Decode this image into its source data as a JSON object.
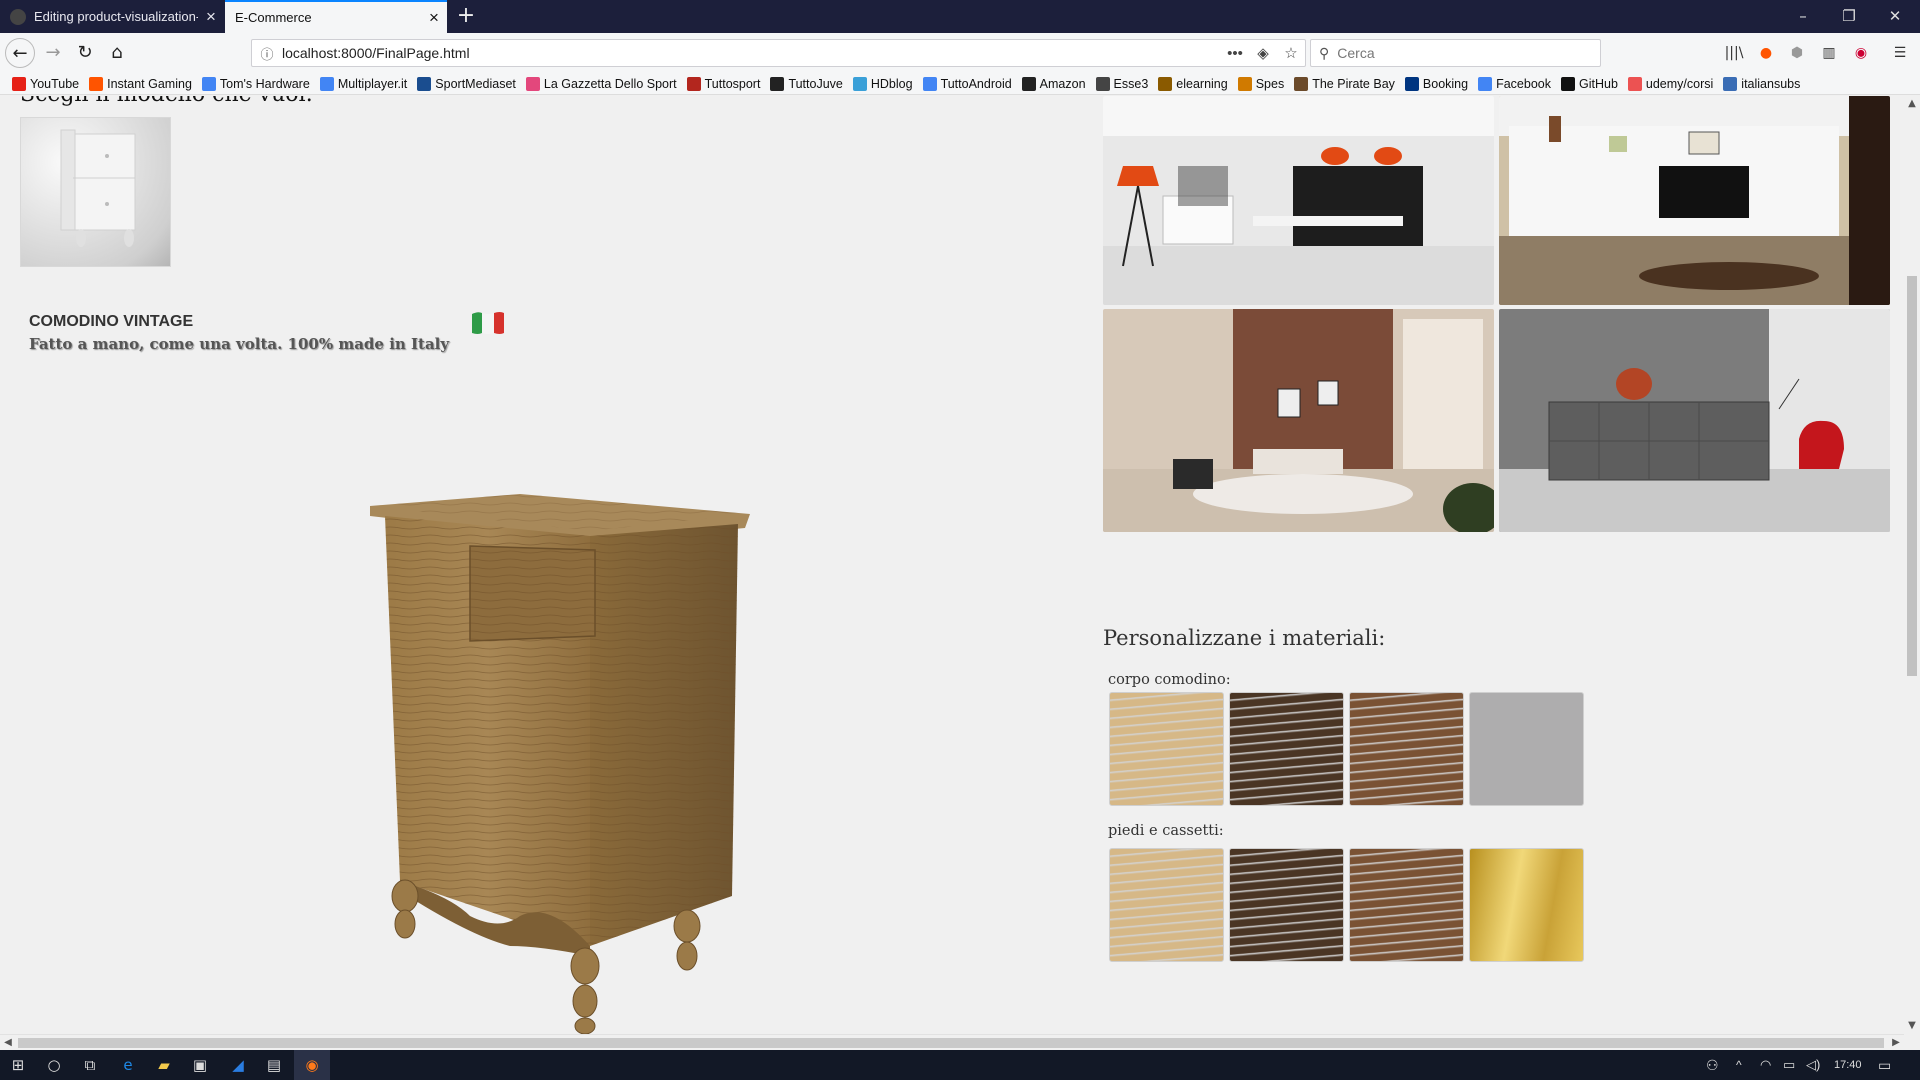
{
  "browser": {
    "tabs": [
      {
        "title": "Editing product-visualization-p",
        "active": false
      },
      {
        "title": "E-Commerce",
        "active": true
      }
    ],
    "url": "localhost:8000/FinalPage.html",
    "search_placeholder": "Cerca",
    "bookmarks": [
      {
        "label": "YouTube",
        "icon": "youtube-icon",
        "color": "#e62117"
      },
      {
        "label": "Instant Gaming",
        "icon": "instant-gaming-icon",
        "color": "#ff5400"
      },
      {
        "label": "Tom's Hardware",
        "icon": "google-icon",
        "color": "#4285f4"
      },
      {
        "label": "Multiplayer.it",
        "icon": "google-icon",
        "color": "#4285f4"
      },
      {
        "label": "SportMediaset",
        "icon": "sportmediaset-icon",
        "color": "#1a4d8f"
      },
      {
        "label": "La Gazzetta Dello Sport",
        "icon": "gazzetta-icon",
        "color": "#e3477c"
      },
      {
        "label": "Tuttosport",
        "icon": "tuttosport-icon",
        "color": "#b3261e"
      },
      {
        "label": "TuttoJuve",
        "icon": "tuttojuve-icon",
        "color": "#222222"
      },
      {
        "label": "HDblog",
        "icon": "hdblog-icon",
        "color": "#3aa0d8"
      },
      {
        "label": "TuttoAndroid",
        "icon": "google-icon",
        "color": "#4285f4"
      },
      {
        "label": "Amazon",
        "icon": "amazon-icon",
        "color": "#222222"
      },
      {
        "label": "Esse3",
        "icon": "globe-icon",
        "color": "#444444"
      },
      {
        "label": "elearning",
        "icon": "elearning-icon",
        "color": "#8a5a00"
      },
      {
        "label": "Spes",
        "icon": "spes-icon",
        "color": "#d07a00"
      },
      {
        "label": "The Pirate Bay",
        "icon": "pirate-bay-icon",
        "color": "#6b4a2a"
      },
      {
        "label": "Booking",
        "icon": "booking-icon",
        "color": "#003580"
      },
      {
        "label": "Facebook",
        "icon": "google-icon",
        "color": "#4285f4"
      },
      {
        "label": "GitHub",
        "icon": "github-icon",
        "color": "#111111"
      },
      {
        "label": "udemy/corsi",
        "icon": "udemy-icon",
        "color": "#ec5252"
      },
      {
        "label": "italiansubs",
        "icon": "italiansubs-icon",
        "color": "#3a6db5"
      }
    ]
  },
  "page": {
    "choose_heading": "Scegli il modello che vuoi:",
    "product": {
      "name": "COMODINO VINTAGE",
      "tagline": "Fatto a mano, come una volta. 100% made in Italy"
    },
    "materials": {
      "heading": "Personalizzane i materiali:",
      "groups": [
        {
          "label": "corpo comodino:",
          "swatches": [
            "light-oak",
            "dark-walnut",
            "medium-walnut",
            "grey"
          ]
        },
        {
          "label": "piedi e cassetti:",
          "swatches": [
            "light-oak",
            "dark-walnut",
            "medium-walnut",
            "gold"
          ]
        }
      ]
    },
    "colors": {
      "light-oak": "#d6b887",
      "dark-walnut": "#4a3524",
      "medium-walnut": "#7a5234",
      "grey": "#aeadae",
      "gold": "#d9b545",
      "background": "#f0f0f0"
    }
  },
  "taskbar": {
    "time": "17:40"
  }
}
